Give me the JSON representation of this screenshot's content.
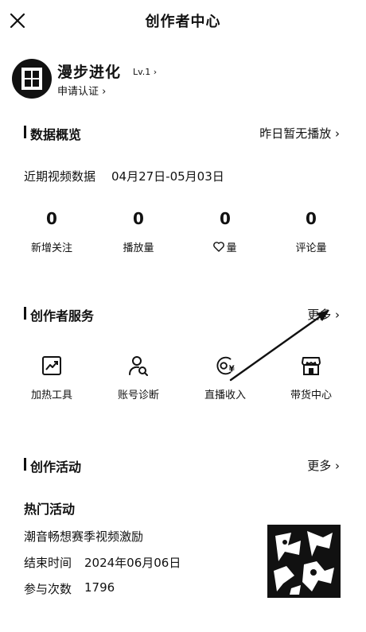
{
  "header": {
    "title": "创作者中心"
  },
  "profile": {
    "name": "漫步进化",
    "level": "Lv.1 ›",
    "verify": "申请认证 ›"
  },
  "overview": {
    "title": "数据概览",
    "link": "昨日暂无播放 ›",
    "range_label": "近期视频数据",
    "range_dates": "04月27日-05月03日",
    "stats": [
      {
        "value": "0",
        "label": "新增关注"
      },
      {
        "value": "0",
        "label": "播放量"
      },
      {
        "value": "0",
        "label": "量"
      },
      {
        "value": "0",
        "label": "评论量"
      }
    ]
  },
  "services": {
    "title": "创作者服务",
    "link": "更多 ›",
    "items": [
      {
        "label": "加热工具",
        "icon": "trend-chart-icon"
      },
      {
        "label": "账号诊断",
        "icon": "user-search-icon"
      },
      {
        "label": "直播收入",
        "icon": "yen-coin-icon"
      },
      {
        "label": "带货中心",
        "icon": "store-icon"
      }
    ]
  },
  "activity": {
    "title": "创作活动",
    "link": "更多 ›",
    "hot_label": "热门活动",
    "event_name": "潮音畅想赛季视频激励",
    "end_label": "结束时间",
    "end_value": "2024年06月06日",
    "count_label": "参与次数",
    "count_value": "1796"
  },
  "colors": {
    "text": "#111111",
    "background": "#ffffff"
  }
}
